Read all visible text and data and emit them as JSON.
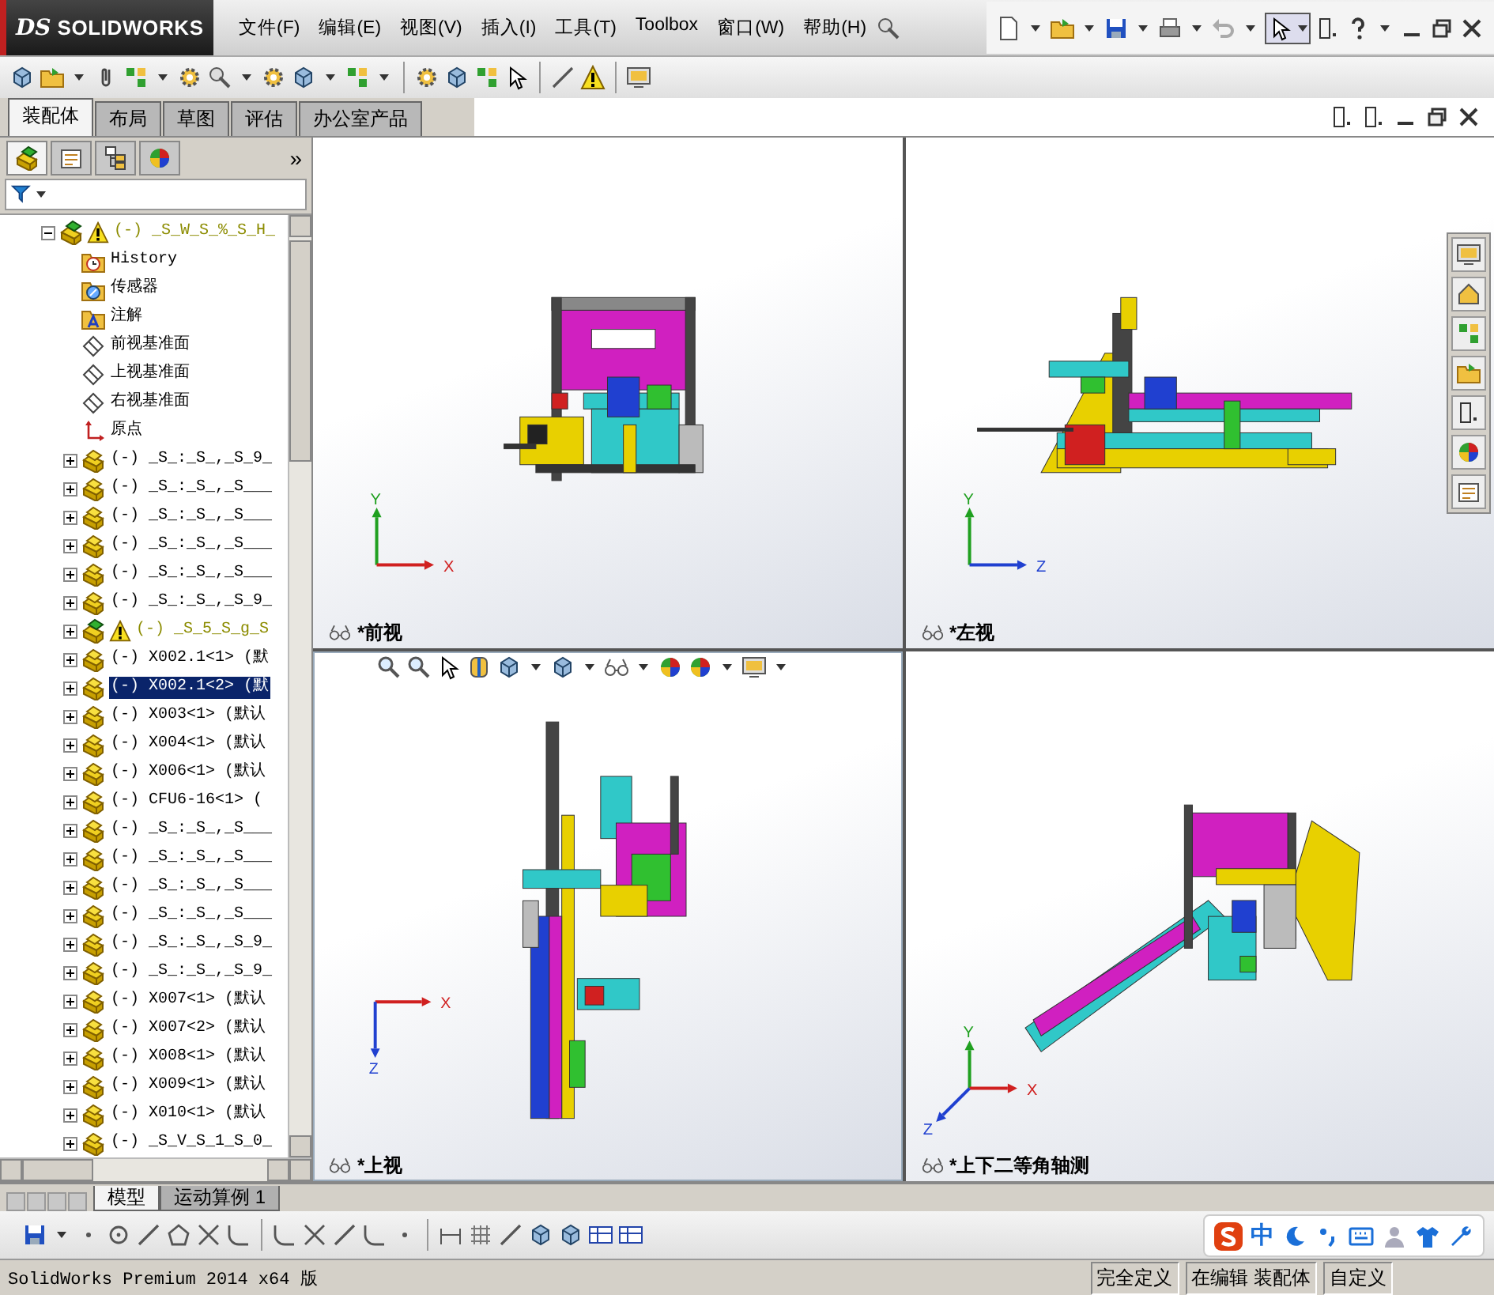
{
  "logo": {
    "mark": "DS",
    "text": "SOLIDWORKS"
  },
  "menu": [
    "文件(F)",
    "编辑(E)",
    "视图(V)",
    "插入(I)",
    "工具(T)",
    "Toolbox",
    "窗口(W)",
    "帮助(H)"
  ],
  "command_tabs": [
    {
      "label": "装配体",
      "selected": true
    },
    {
      "label": "布局",
      "selected": false
    },
    {
      "label": "草图",
      "selected": false
    },
    {
      "label": "评估",
      "selected": false
    },
    {
      "label": "办公室产品",
      "selected": false
    }
  ],
  "panel_tabs": [
    {
      "selected": true
    },
    {
      "selected": false
    },
    {
      "selected": false
    },
    {
      "selected": false
    }
  ],
  "panel_more": "»",
  "tree": {
    "label": "(-) _S_W_S_%_S_H_",
    "kind": "assembly",
    "warning": true,
    "expanded": true,
    "selected": false,
    "children": [
      {
        "label": "History",
        "kind": "history",
        "selected": false
      },
      {
        "label": "传感器",
        "kind": "sensor",
        "selected": false
      },
      {
        "label": "注解",
        "kind": "annotation",
        "selected": false
      },
      {
        "label": "前视基准面",
        "kind": "plane",
        "selected": false
      },
      {
        "label": "上视基准面",
        "kind": "plane",
        "selected": false
      },
      {
        "label": "右视基准面",
        "kind": "plane",
        "selected": false
      },
      {
        "label": "原点",
        "kind": "origin",
        "selected": false
      },
      {
        "label": "(-) _S_:_S_,_S_9_",
        "kind": "part",
        "warning": false,
        "expanded": false,
        "selected": false
      },
      {
        "label": "(-) _S_:_S_,_S___",
        "kind": "part",
        "warning": false,
        "expanded": false,
        "selected": false
      },
      {
        "label": "(-) _S_:_S_,_S___",
        "kind": "part",
        "warning": false,
        "expanded": false,
        "selected": false
      },
      {
        "label": "(-) _S_:_S_,_S___",
        "kind": "part",
        "warning": false,
        "expanded": false,
        "selected": false
      },
      {
        "label": "(-) _S_:_S_,_S___",
        "kind": "part",
        "warning": false,
        "expanded": false,
        "selected": false
      },
      {
        "label": "(-) _S_:_S_,_S_9_",
        "kind": "part",
        "warning": false,
        "expanded": false,
        "selected": false
      },
      {
        "label": "(-) _S_5_S_g_S",
        "kind": "assembly",
        "warning": true,
        "expanded": false,
        "selected": false
      },
      {
        "label": "(-) X002.1<1> (默",
        "kind": "part",
        "warning": false,
        "expanded": false,
        "selected": false
      },
      {
        "label": "(-) X002.1<2> (默",
        "kind": "part",
        "warning": false,
        "expanded": false,
        "selected": true
      },
      {
        "label": "(-) X003<1> (默认",
        "kind": "part",
        "warning": false,
        "expanded": false,
        "selected": false
      },
      {
        "label": "(-) X004<1> (默认",
        "kind": "part",
        "warning": false,
        "expanded": false,
        "selected": false
      },
      {
        "label": "(-) X006<1> (默认",
        "kind": "part",
        "warning": false,
        "expanded": false,
        "selected": false
      },
      {
        "label": "(-) CFU6-16<1> (",
        "kind": "part",
        "warning": false,
        "expanded": false,
        "selected": false
      },
      {
        "label": "(-) _S_:_S_,_S___",
        "kind": "part",
        "warning": false,
        "expanded": false,
        "selected": false
      },
      {
        "label": "(-) _S_:_S_,_S___",
        "kind": "part",
        "warning": false,
        "expanded": false,
        "selected": false
      },
      {
        "label": "(-) _S_:_S_,_S___",
        "kind": "part",
        "warning": false,
        "expanded": false,
        "selected": false
      },
      {
        "label": "(-) _S_:_S_,_S___",
        "kind": "part",
        "warning": false,
        "expanded": false,
        "selected": false
      },
      {
        "label": "(-) _S_:_S_,_S_9_",
        "kind": "part",
        "warning": false,
        "expanded": false,
        "selected": false
      },
      {
        "label": "(-) _S_:_S_,_S_9_",
        "kind": "part",
        "warning": false,
        "expanded": false,
        "selected": false
      },
      {
        "label": "(-) X007<1> (默认",
        "kind": "part",
        "warning": false,
        "expanded": false,
        "selected": false
      },
      {
        "label": "(-) X007<2> (默认",
        "kind": "part",
        "warning": false,
        "expanded": false,
        "selected": false
      },
      {
        "label": "(-) X008<1> (默认",
        "kind": "part",
        "warning": false,
        "expanded": false,
        "selected": false
      },
      {
        "label": "(-) X009<1> (默认",
        "kind": "part",
        "warning": false,
        "expanded": false,
        "selected": false
      },
      {
        "label": "(-) X010<1> (默认",
        "kind": "part",
        "warning": false,
        "expanded": false,
        "selected": false
      },
      {
        "label": "(-) _S_V_S_1_S_0_",
        "kind": "part",
        "warning": false,
        "expanded": false,
        "selected": false
      }
    ]
  },
  "views": [
    {
      "label": "*前视",
      "kind": "front",
      "active": false,
      "axes": [
        {
          "label": "Y",
          "color": "#20a020"
        },
        {
          "label": "X",
          "color": "#d02020"
        }
      ]
    },
    {
      "label": "*左视",
      "kind": "left",
      "active": false,
      "axes": [
        {
          "label": "Y",
          "color": "#20a020"
        },
        {
          "label": "Z",
          "color": "#2040d0"
        }
      ]
    },
    {
      "label": "*上视",
      "kind": "top",
      "active": true,
      "axes": [
        {
          "label": "X",
          "color": "#d02020"
        },
        {
          "label": "Z",
          "color": "#2040d0"
        }
      ]
    },
    {
      "label": "*上下二等角轴测",
      "kind": "iso",
      "active": false,
      "axes": [
        {
          "label": "Y",
          "color": "#20a020"
        },
        {
          "label": "X",
          "color": "#d02020"
        },
        {
          "label": "Z",
          "color": "#2040d0"
        }
      ]
    }
  ],
  "bottom_tabs": [
    {
      "label": "模型",
      "selected": true
    },
    {
      "label": "运动算例 1",
      "selected": false
    }
  ],
  "status_bar": {
    "product": "SolidWorks Premium 2014 x64 版",
    "fields": [
      "完全定义",
      "在编辑 装配体",
      "自定义"
    ]
  },
  "ime": {
    "mode": "中"
  }
}
